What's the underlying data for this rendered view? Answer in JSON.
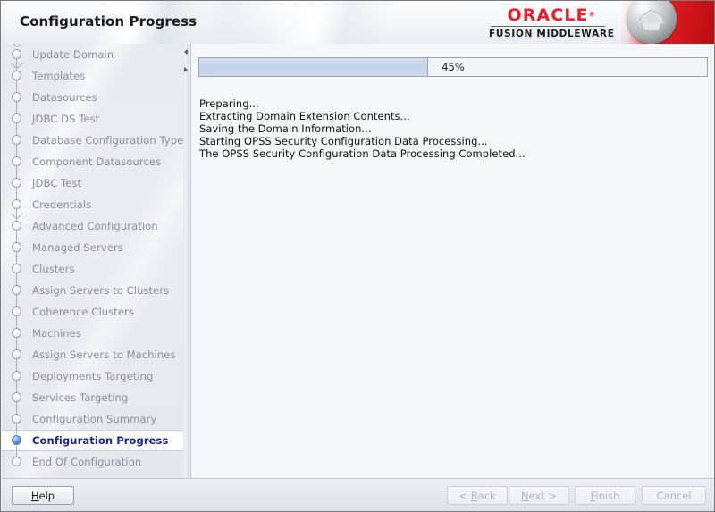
{
  "window": {
    "title": "Configuration Progress"
  },
  "header": {
    "title": "Configuration Progress",
    "brand": {
      "name": "ORACLE",
      "trademark": "®",
      "product": "FUSION MIDDLEWARE",
      "badge_icon": "oracle-pentagon-badge-icon",
      "accent_color": "#e8212b",
      "red_panel_color": "#d0151a"
    }
  },
  "sidebar": {
    "items": [
      {
        "label": "Update Domain",
        "state": "done",
        "branch": true
      },
      {
        "label": "Templates",
        "state": "done",
        "branch": true
      },
      {
        "label": "Datasources",
        "state": "done",
        "branch": false
      },
      {
        "label": "JDBC DS Test",
        "state": "done",
        "branch": false
      },
      {
        "label": "Database Configuration Type",
        "state": "done",
        "branch": false
      },
      {
        "label": "Component Datasources",
        "state": "done",
        "branch": false
      },
      {
        "label": "JDBC Test",
        "state": "done",
        "branch": false
      },
      {
        "label": "Credentials",
        "state": "done",
        "branch": false
      },
      {
        "label": "Advanced Configuration",
        "state": "done",
        "branch": true
      },
      {
        "label": "Managed Servers",
        "state": "done",
        "branch": false
      },
      {
        "label": "Clusters",
        "state": "done",
        "branch": false
      },
      {
        "label": "Assign Servers to Clusters",
        "state": "done",
        "branch": false
      },
      {
        "label": "Coherence Clusters",
        "state": "done",
        "branch": false
      },
      {
        "label": "Machines",
        "state": "done",
        "branch": false
      },
      {
        "label": "Assign Servers to Machines",
        "state": "done",
        "branch": false
      },
      {
        "label": "Deployments Targeting",
        "state": "done",
        "branch": false
      },
      {
        "label": "Services Targeting",
        "state": "done",
        "branch": false
      },
      {
        "label": "Configuration Summary",
        "state": "done",
        "branch": false
      },
      {
        "label": "Configuration Progress",
        "state": "active",
        "branch": false
      },
      {
        "label": "End Of Configuration",
        "state": "pending",
        "branch": false
      }
    ],
    "active_color": "#13239c"
  },
  "content": {
    "progress": {
      "percent": 45,
      "percent_label": "45%",
      "fill_color": "#c3d2e9"
    },
    "log_lines": [
      "Preparing...",
      "Extracting Domain Extension Contents...",
      "Saving the Domain Information...",
      "Starting OPSS Security Configuration Data Processing...",
      "The OPSS Security Configuration Data Processing Completed..."
    ]
  },
  "footer": {
    "buttons": [
      {
        "label": "Help",
        "mnemonic": "H",
        "enabled": true
      },
      {
        "label": "< Back",
        "mnemonic": "B",
        "enabled": false
      },
      {
        "label": "Next >",
        "mnemonic": "N",
        "enabled": false
      },
      {
        "label": "Finish",
        "mnemonic": "F",
        "enabled": false
      },
      {
        "label": "Cancel",
        "mnemonic": "",
        "enabled": false
      }
    ]
  }
}
